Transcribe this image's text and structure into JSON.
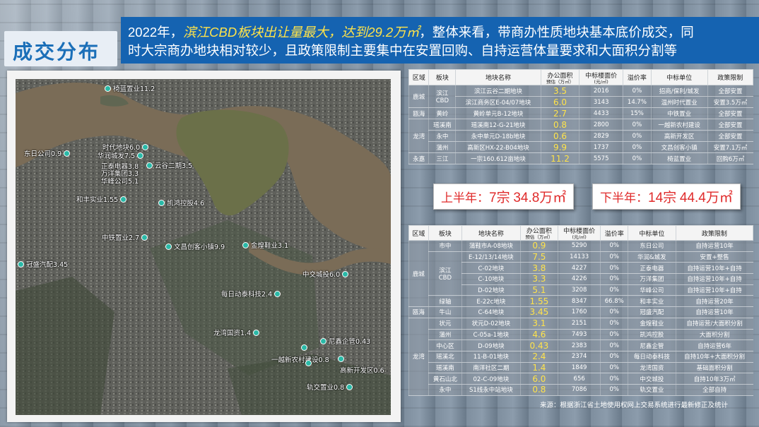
{
  "title": "成交分布",
  "banner": {
    "line1_prefix": "2022年，",
    "line1_highlight": "滨江CBD板块出让量最大，达到29.2万㎡",
    "line1_suffix": "，整体来看，带商办性质地块基本底价成交，同",
    "line2": "时大宗商办地块相对较少，且政策限制主要集中在安置回购、自持运营体量要求和大面积分割等"
  },
  "map_labels": [
    {
      "name": "椅蓝置业11.2"
    },
    {
      "name": "时代地块6.0"
    },
    {
      "name": "东日公司0.9"
    },
    {
      "name": "华润城发7.5"
    },
    {
      "name": "正泰电器3.8"
    },
    {
      "name": "万洋集团3.3"
    },
    {
      "name": "华峰公司5.1"
    },
    {
      "name": "云谷二期3.5"
    },
    {
      "name": "和丰实业1.55"
    },
    {
      "name": "凯鸿控股4.6"
    },
    {
      "name": "中铁置业2.7"
    },
    {
      "name": "文昌创客小镇9.9"
    },
    {
      "name": "金煌鞋业3.1"
    },
    {
      "name": "冠盛汽配3.45"
    },
    {
      "name": "中交城投6.0"
    },
    {
      "name": "每日动泰科技2.4"
    },
    {
      "name": "龙湾国资1.4"
    },
    {
      "name": "尼鑫企管0.43"
    },
    {
      "name": "一越新农村建设0.8"
    },
    {
      "name": "高新开发区0.6"
    },
    {
      "name": "轨交置业0.8"
    }
  ],
  "table1": {
    "headers": [
      "区域",
      "板块",
      "地块名称",
      "办公面积",
      "预估（万㎡）",
      "中标楼面价",
      "(元/㎡)",
      "溢价率",
      "中标单位",
      "政策限制"
    ],
    "rows": [
      {
        "region": "鹿城",
        "block": "滨江",
        "block2": "CBD",
        "name": "滨江云谷二期地块",
        "area": "3.5",
        "price": "2016",
        "premium": "0%",
        "winner": "招商/保利/城发",
        "policy": "全部安置"
      },
      {
        "region": "",
        "block": "",
        "block2": "",
        "name": "滨江商务区E-04/07地块",
        "area": "6.0",
        "price": "3143",
        "premium": "14.7%",
        "winner": "温州时代置业",
        "policy": "安置3.5万㎡"
      },
      {
        "region": "瓯海",
        "block": "黄岭",
        "block2": "",
        "name": "黄岭单元B-12地块",
        "area": "2.7",
        "price": "4433",
        "premium": "15%",
        "winner": "中铁置业",
        "policy": "全部安置"
      },
      {
        "region": "龙湾",
        "block": "瑶溪南",
        "block2": "",
        "name": "瑶溪南12-G-21地块",
        "area": "0.8",
        "price": "2800",
        "premium": "0%",
        "winner": "一越新农村建设",
        "policy": "全部安置"
      },
      {
        "region": "",
        "block": "永中",
        "block2": "",
        "name": "永中单元D-18b地块",
        "area": "0.6",
        "price": "2829",
        "premium": "0%",
        "winner": "高新开发区",
        "policy": "全部安置"
      },
      {
        "region": "",
        "block": "蒲州",
        "block2": "",
        "name": "高新区HX-22-B04地块",
        "area": "9.9",
        "price": "1737",
        "premium": "0%",
        "winner": "文昌创客小镇",
        "policy": "安置7.1万㎡"
      },
      {
        "region": "永嘉",
        "block": "三江",
        "block2": "",
        "name": "一宗160.612亩地块",
        "area": "11.2",
        "price": "5575",
        "premium": "0%",
        "winner": "椅蓝置业",
        "policy": "回购6万㎡"
      }
    ]
  },
  "callouts": {
    "h1_prefix": "上半年：",
    "h1_count": "7宗",
    "h1_area": "34.8万㎡",
    "h2_prefix": "下半年：",
    "h2_count": "14宗",
    "h2_area": "44.4万㎡"
  },
  "table2": {
    "headers": [
      "区域",
      "板块",
      "地块名称",
      "办公面积",
      "预估（万㎡）",
      "中标楼面价",
      "(元/㎡)",
      "溢价率",
      "中标单位",
      "政策限制"
    ],
    "rows": [
      {
        "region": "",
        "block": "市中",
        "name": "蒲鞋市A-08地块",
        "area": "0.9",
        "price": "5290",
        "premium": "0%",
        "winner": "东日公司",
        "policy": "自持运营10年"
      },
      {
        "region": "",
        "block": "",
        "name": "E-12/13/14地块",
        "area": "7.5",
        "price": "14133",
        "premium": "0%",
        "winner": "华润&城发",
        "policy": "安置+整售"
      },
      {
        "region": "鹿城",
        "block": "滨江",
        "name": "C-02地块",
        "area": "3.8",
        "price": "4227",
        "premium": "0%",
        "winner": "正泰电器",
        "policy": "自持运营10年+自持"
      },
      {
        "region": "",
        "block": "CBD",
        "name": "C-10地块",
        "area": "3.3",
        "price": "4226",
        "premium": "0%",
        "winner": "万洋集团",
        "policy": "自持运营10年+自持"
      },
      {
        "region": "",
        "block": "",
        "name": "D-02地块",
        "area": "5.1",
        "price": "3208",
        "premium": "0%",
        "winner": "华峰公司",
        "policy": "自持运营10年+自持"
      },
      {
        "region": "",
        "block": "绿轴",
        "name": "E-22c地块",
        "area": "1.55",
        "price": "8347",
        "premium": "66.8%",
        "winner": "和丰实业",
        "policy": "自持运营20年"
      },
      {
        "region": "瓯海",
        "block": "牛山",
        "name": "C-64地块",
        "area": "3.45",
        "price": "1760",
        "premium": "0%",
        "winner": "冠盛汽配",
        "policy": "自持运营10年"
      },
      {
        "region": "",
        "block": "状元",
        "name": "状元D-02地块",
        "area": "3.1",
        "price": "2151",
        "premium": "0%",
        "winner": "金煌鞋业",
        "policy": "自持运营/大面积分割"
      },
      {
        "region": "",
        "block": "蒲州",
        "name": "C-05a-1地块",
        "area": "4.6",
        "price": "7493",
        "premium": "0%",
        "winner": "凯鸿控股",
        "policy": "大面积分割"
      },
      {
        "region": "",
        "block": "中心区",
        "name": "D-09地块",
        "area": "0.43",
        "price": "2383",
        "premium": "0%",
        "winner": "尼鑫企管",
        "policy": "自持运营6年"
      },
      {
        "region": "龙湾",
        "block": "瑶溪北",
        "name": "11-B-01地块",
        "area": "2.4",
        "price": "2374",
        "premium": "0%",
        "winner": "每日动泰科技",
        "policy": "自持10年+大面积分割"
      },
      {
        "region": "",
        "block": "瑶溪南",
        "name": "南洋社区二期",
        "area": "1.4",
        "price": "1849",
        "premium": "0%",
        "winner": "龙湾国资",
        "policy": "基础面积分割"
      },
      {
        "region": "",
        "block": "黄石山北",
        "name": "02-C-09地块",
        "area": "6.0",
        "price": "656",
        "premium": "0%",
        "winner": "中交城投",
        "policy": "自持10年3万㎡"
      },
      {
        "region": "",
        "block": "永中",
        "name": "S1线永中站地块",
        "area": "0.8",
        "price": "7086",
        "premium": "0%",
        "winner": "轨交置业",
        "policy": "全部自持"
      }
    ]
  },
  "source": "来源：根据浙江省土地使用权网上交易系统进行最新修正及统计"
}
